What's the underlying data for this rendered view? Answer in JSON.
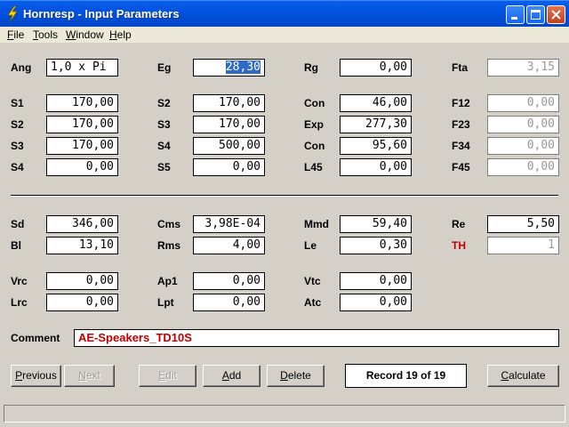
{
  "window": {
    "title": "Hornresp - Input Parameters",
    "icon": "lightning-icon"
  },
  "menu": [
    {
      "label": "File",
      "accel": "F",
      "rest": "ile"
    },
    {
      "label": "Tools",
      "accel": "T",
      "rest": "ools"
    },
    {
      "label": "Window",
      "accel": "W",
      "rest": "indow"
    },
    {
      "label": "Help",
      "accel": "H",
      "rest": "elp"
    }
  ],
  "fields": {
    "ang": {
      "label": "Ang",
      "value": "1,0 x Pi"
    },
    "eg": {
      "label": "Eg",
      "value": "28,30"
    },
    "rg": {
      "label": "Rg",
      "value": "0,00"
    },
    "fta": {
      "label": "Fta",
      "value": "3,15"
    },
    "s1a": {
      "label": "S1",
      "value": "170,00"
    },
    "s2b": {
      "label": "S2",
      "value": "170,00"
    },
    "con1": {
      "label": "Con",
      "value": "46,00"
    },
    "f12": {
      "label": "F12",
      "value": "0,00"
    },
    "s2a": {
      "label": "S2",
      "value": "170,00"
    },
    "s3b": {
      "label": "S3",
      "value": "170,00"
    },
    "exp": {
      "label": "Exp",
      "value": "277,30"
    },
    "f23": {
      "label": "F23",
      "value": "0,00"
    },
    "s3a": {
      "label": "S3",
      "value": "170,00"
    },
    "s4b": {
      "label": "S4",
      "value": "500,00"
    },
    "con2": {
      "label": "Con",
      "value": "95,60"
    },
    "f34": {
      "label": "F34",
      "value": "0,00"
    },
    "s4a": {
      "label": "S4",
      "value": "0,00"
    },
    "s5b": {
      "label": "S5",
      "value": "0,00"
    },
    "l45": {
      "label": "L45",
      "value": "0,00"
    },
    "f45": {
      "label": "F45",
      "value": "0,00"
    },
    "sd": {
      "label": "Sd",
      "value": "346,00"
    },
    "cms": {
      "label": "Cms",
      "value": "3,98E-04"
    },
    "mmd": {
      "label": "Mmd",
      "value": "59,40"
    },
    "re": {
      "label": "Re",
      "value": "5,50"
    },
    "bl": {
      "label": "Bl",
      "value": "13,10"
    },
    "rms": {
      "label": "Rms",
      "value": "4,00"
    },
    "le": {
      "label": "Le",
      "value": "0,30"
    },
    "th": {
      "label": "TH",
      "value": "1"
    },
    "vrc": {
      "label": "Vrc",
      "value": "0,00"
    },
    "ap1": {
      "label": "Ap1",
      "value": "0,00"
    },
    "vtc": {
      "label": "Vtc",
      "value": "0,00"
    },
    "lrc": {
      "label": "Lrc",
      "value": "0,00"
    },
    "lpt": {
      "label": "Lpt",
      "value": "0,00"
    },
    "atc": {
      "label": "Atc",
      "value": "0,00"
    }
  },
  "comment": {
    "label": "Comment",
    "value": "AE-Speakers_TD10S"
  },
  "buttons": {
    "previous": {
      "accel": "P",
      "rest": "revious"
    },
    "next": {
      "accel": "N",
      "rest": "ext"
    },
    "edit": {
      "accel": "E",
      "rest": "dit"
    },
    "add": {
      "accel": "A",
      "rest": "dd"
    },
    "delete": {
      "accel": "D",
      "rest": "elete"
    },
    "calculate": {
      "accel": "C",
      "rest": "alculate"
    }
  },
  "record": "Record 19 of 19",
  "colors": {
    "titlebar": "#0052e0",
    "th_label": "#c00000",
    "comment_text": "#c00000",
    "selection": "#316ac5"
  }
}
